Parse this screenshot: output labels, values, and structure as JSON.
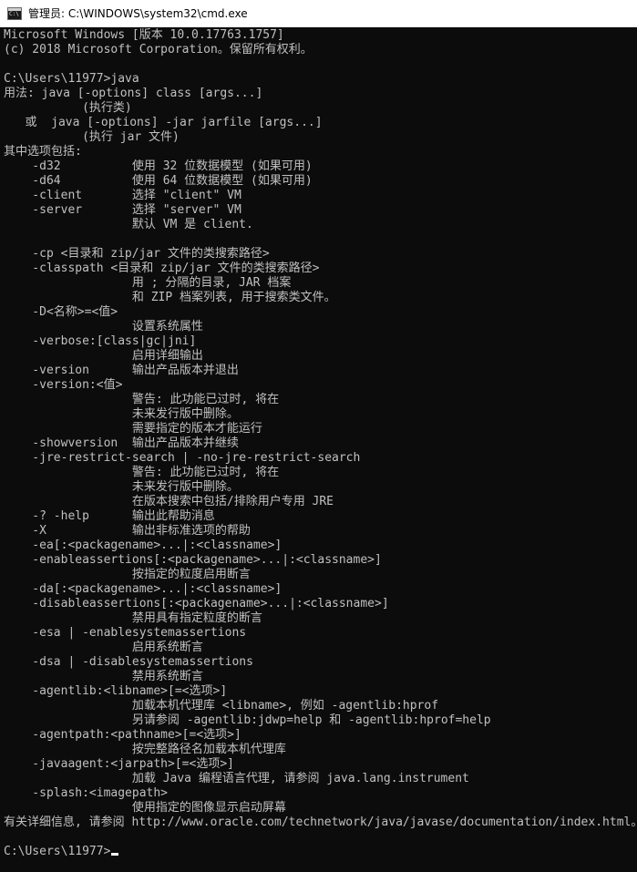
{
  "window": {
    "title": "管理员: C:\\WINDOWS\\system32\\cmd.exe",
    "icon": "cmd-console-icon"
  },
  "colors": {
    "background": "#0c0c0c",
    "text": "#c0c0c0",
    "titlebar": "#ffffff"
  },
  "console": {
    "lines": [
      "Microsoft Windows [版本 10.0.17763.1757]",
      "(c) 2018 Microsoft Corporation。保留所有权利。",
      "",
      "C:\\Users\\11977>java",
      "用法: java [-options] class [args...]",
      "           (执行类)",
      "   或  java [-options] -jar jarfile [args...]",
      "           (执行 jar 文件)",
      "其中选项包括:",
      "    -d32          使用 32 位数据模型 (如果可用)",
      "    -d64          使用 64 位数据模型 (如果可用)",
      "    -client       选择 \"client\" VM",
      "    -server       选择 \"server\" VM",
      "                  默认 VM 是 client.",
      "",
      "    -cp <目录和 zip/jar 文件的类搜索路径>",
      "    -classpath <目录和 zip/jar 文件的类搜索路径>",
      "                  用 ; 分隔的目录, JAR 档案",
      "                  和 ZIP 档案列表, 用于搜索类文件。",
      "    -D<名称>=<值>",
      "                  设置系统属性",
      "    -verbose:[class|gc|jni]",
      "                  启用详细输出",
      "    -version      输出产品版本并退出",
      "    -version:<值>",
      "                  警告: 此功能已过时, 将在",
      "                  未来发行版中删除。",
      "                  需要指定的版本才能运行",
      "    -showversion  输出产品版本并继续",
      "    -jre-restrict-search | -no-jre-restrict-search",
      "                  警告: 此功能已过时, 将在",
      "                  未来发行版中删除。",
      "                  在版本搜索中包括/排除用户专用 JRE",
      "    -? -help      输出此帮助消息",
      "    -X            输出非标准选项的帮助",
      "    -ea[:<packagename>...|:<classname>]",
      "    -enableassertions[:<packagename>...|:<classname>]",
      "                  按指定的粒度启用断言",
      "    -da[:<packagename>...|:<classname>]",
      "    -disableassertions[:<packagename>...|:<classname>]",
      "                  禁用具有指定粒度的断言",
      "    -esa | -enablesystemassertions",
      "                  启用系统断言",
      "    -dsa | -disablesystemassertions",
      "                  禁用系统断言",
      "    -agentlib:<libname>[=<选项>]",
      "                  加载本机代理库 <libname>, 例如 -agentlib:hprof",
      "                  另请参阅 -agentlib:jdwp=help 和 -agentlib:hprof=help",
      "    -agentpath:<pathname>[=<选项>]",
      "                  按完整路径名加载本机代理库",
      "    -javaagent:<jarpath>[=<选项>]",
      "                  加载 Java 编程语言代理, 请参阅 java.lang.instrument",
      "    -splash:<imagepath>",
      "                  使用指定的图像显示启动屏幕",
      "有关详细信息, 请参阅 http://www.oracle.com/technetwork/java/javase/documentation/index.html。",
      "",
      "C:\\Users\\11977>"
    ]
  }
}
